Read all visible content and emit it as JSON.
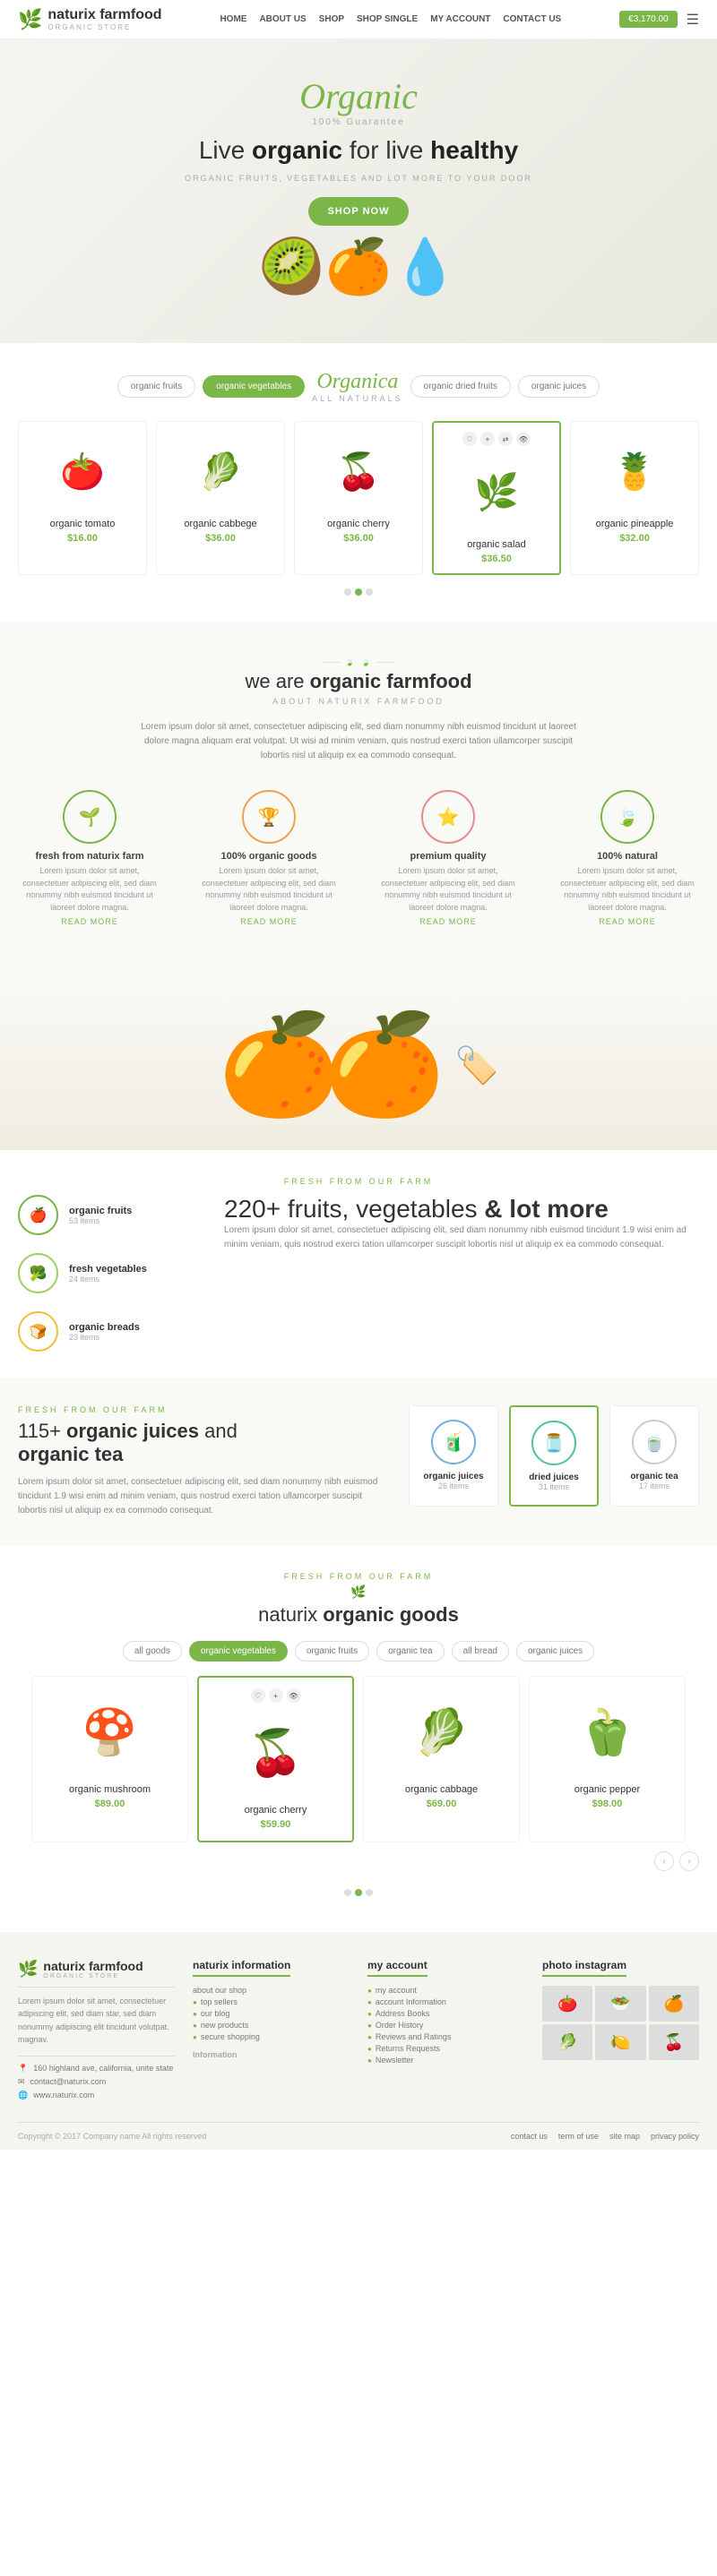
{
  "header": {
    "logo_name": "naturix farmfood",
    "logo_sub": "organic store",
    "nav": [
      "HOME",
      "ABOUT US",
      "SHOP",
      "SHOP SINGLE",
      "MY ACCOUNT",
      "CONTACT US"
    ],
    "cart_label": "€3,170.00"
  },
  "hero": {
    "organic_text": "Organic",
    "guarantee": "100% Guarantee",
    "tagline_start": "Live ",
    "tagline_bold1": "organic",
    "tagline_mid": " for live ",
    "tagline_bold2": "healthy",
    "sub": "ORGANIC FRUITS, VEGETABLES AND LOT MORE TO YOUR DOOR",
    "shop_now": "SHOP NOW"
  },
  "categories": {
    "tabs": [
      "organic fruits",
      "organic vegetables",
      "organic dried fruits",
      "organic juices"
    ],
    "active": "organic vegetables",
    "badge_text": "Organica",
    "badge_sub": "ALL NATURALS"
  },
  "products": [
    {
      "name": "organic tomato",
      "price": "$16.00",
      "emoji": "🍅"
    },
    {
      "name": "organic cabbege",
      "price": "$36.00",
      "emoji": "🥬"
    },
    {
      "name": "organic cherry",
      "price": "$36.00",
      "emoji": "🍒"
    },
    {
      "name": "organic salad",
      "price": "$36.50",
      "emoji": "🌿"
    },
    {
      "name": "organic pineapple",
      "price": "$32.00",
      "emoji": "🍍"
    }
  ],
  "about": {
    "title_start": "we are ",
    "title_bold": "organic farmfood",
    "sub": "ABOUT NATURIX FARMFOOD",
    "text": "Lorem ipsum dolor sit amet, consectetuer adipiscing elit, sed diam nonummy nibh euismod tincidunt ut laoreet dolore magna aliquam erat volutpat. Ut wisi ad minim veniam, quis nostrud exerci tation ullamcorper suscipit lobortis nisl ut aliquip ex ea commodo consequat.",
    "features": [
      {
        "name": "fresh from naturix farm",
        "icon": "🌱",
        "color": "green",
        "text": "Lorem ipsum dolor sit amet, consectetuer adipiscing elit, sed diam nonummy nibh euismod tincidunt ut laoreet dolore magna."
      },
      {
        "name": "100% organic goods",
        "icon": "🏆",
        "color": "orange",
        "text": "Lorem ipsum dolor sit amet, consectetuer adipiscing elit, sed diam nonummy nibh euismod tincidunt ut laoreet dolore magna."
      },
      {
        "name": "premium quality",
        "icon": "⭐",
        "color": "pink",
        "text": "Lorem ipsum dolor sit amet, consectetuer adipiscing elit, sed diam nonummy nibh euismod tincidunt ut laoreet dolore magna."
      },
      {
        "name": "100% natural",
        "icon": "🍃",
        "color": "green",
        "text": "Lorem ipsum dolor sit amet, consectetuer adipiscing elit, sed diam nonummy nibh euismod tincidunt ut laoreet dolore magna."
      }
    ],
    "read_more": "READ MORE"
  },
  "fresh_section": {
    "label": "FRESH FROM OUR FARM",
    "stats": [
      {
        "name": "organic fruits",
        "count": "53 items",
        "icon": "🍎",
        "color": "green"
      },
      {
        "name": "fresh vegetables",
        "count": "24 items",
        "icon": "🥦",
        "color": "lightgreen"
      },
      {
        "name": "organic breads",
        "count": "23 items",
        "icon": "🍞",
        "color": "yellow"
      }
    ],
    "big_number": "220+",
    "big_title_start": "fruits, vegetables",
    "big_title_bold": " & lot more",
    "big_text": "Lorem ipsum dolor sit amet, consectetuer adipiscing elit, sed diam nonummy nibh euismod tincidunt 1.9 wisi enim ad minim veniam, quis nostrud exerci tation ullamcorper suscipit lobortis nisl ut aliquip ex ea commodo consequat."
  },
  "juices_section": {
    "label": "FRESH FROM OUR FARM",
    "title_start": "115+ ",
    "title_bold1": "organic juices",
    "title_mid": " and ",
    "title_bold2": "organic tea",
    "text": "Lorem ipsum dolor sit amet, consectetuer adipiscing elit, sed diam nonummy nibh euismod tincidunt 1.9 wisi enim ad minim veniam, quis nostrud exerci tation ullamcorper suscipit lobortis nisl ut aliquip ex ea commodo consequat.",
    "juices": [
      {
        "name": "organic juices",
        "count": "26 items",
        "icon": "🧃",
        "color": "blue"
      },
      {
        "name": "dried juices",
        "count": "31 items",
        "icon": "🫙",
        "color": "teal",
        "active": true
      },
      {
        "name": "organic tea",
        "count": "17 items",
        "icon": "🍵",
        "color": "gray"
      }
    ]
  },
  "goods_section": {
    "label": "FRESH FROM OUR FARM",
    "title_start": "naturix ",
    "title_bold": "organic goods",
    "tabs": [
      "all goods",
      "organic vegetables",
      "organic fruits",
      "organic tea",
      "all bread",
      "organic juices"
    ],
    "active_tab": "organic vegetables",
    "products": [
      {
        "name": "organic mushroom",
        "price": "$89.00",
        "emoji": "🍄"
      },
      {
        "name": "organic cherry",
        "price": "$59.90",
        "emoji": "🍒",
        "featured": true
      },
      {
        "name": "organic cabbage",
        "price": "$69.00",
        "emoji": "🥬"
      },
      {
        "name": "organic pepper",
        "price": "$98.00",
        "emoji": "🫑"
      }
    ]
  },
  "footer": {
    "logo_name": "naturix farmfood",
    "logo_sub": "ORGANIC STORE",
    "col1_text": "Lorem ipsum dolor sit amet, consectetuer adipiscing elit, sed diam star, sed diam nonummy adipiscing elit tincidunt volutpat. magnav.",
    "col1_contacts": [
      {
        "icon": "📍",
        "text": "160 highland ave, california, unite state"
      },
      {
        "icon": "✉",
        "text": "contact@naturix.com"
      },
      {
        "icon": "🌐",
        "text": "www.naturix.com"
      }
    ],
    "col2_title": "naturix information",
    "col2_links": [
      "about our shop",
      "top sellers",
      "our blog",
      "new products",
      "secure shopping"
    ],
    "col3_title": "my account",
    "col3_links": [
      "my account",
      "account Information",
      "Address Books",
      "Order History",
      "Reviews and Ratings",
      "Returns Requests",
      "Newsletter"
    ],
    "col4_title": "photo instagram",
    "instagram_emojis": [
      "🍅",
      "🥗",
      "🍊",
      "🥬",
      "🍋",
      "🍒"
    ],
    "information_label": "Information",
    "bottom_links": [
      "contact us",
      "term of use",
      "site map",
      "privacy policy"
    ],
    "copyright": "Copyright © 2017 Company name All rights reserved"
  }
}
